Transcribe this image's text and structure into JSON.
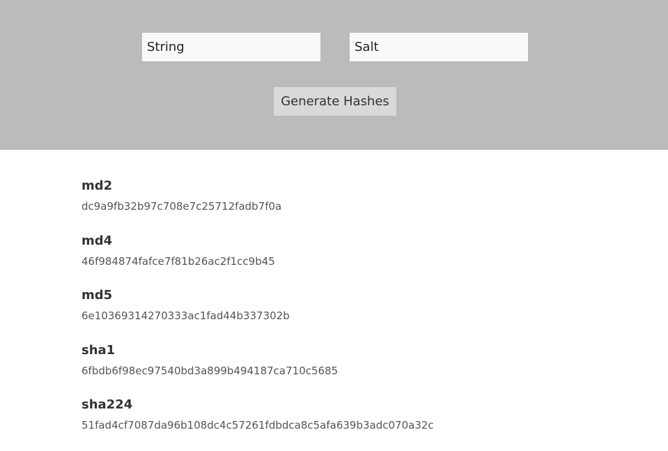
{
  "form": {
    "string_placeholder": "String",
    "salt_placeholder": "Salt",
    "generate_label": "Generate Hashes"
  },
  "results": [
    {
      "algo": "md2",
      "hash": "dc9a9fb32b97c708e7c25712fadb7f0a"
    },
    {
      "algo": "md4",
      "hash": "46f984874fafce7f81b26ac2f1cc9b45"
    },
    {
      "algo": "md5",
      "hash": "6e10369314270333ac1fad44b337302b"
    },
    {
      "algo": "sha1",
      "hash": "6fbdb6f98ec97540bd3a899b494187ca710c5685"
    },
    {
      "algo": "sha224",
      "hash": "51fad4cf7087da96b108dc4c57261fdbdca8c5afa639b3adc070a32c"
    }
  ]
}
